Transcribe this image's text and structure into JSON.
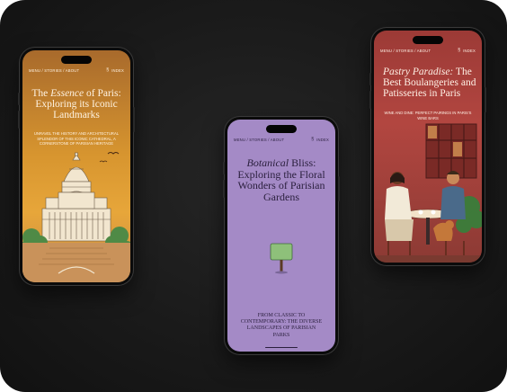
{
  "phones": [
    {
      "nav": {
        "links": "MENU / STORIES / ABOUT",
        "index": "INDEX"
      },
      "title": {
        "italic": "Essence",
        "pre": "The ",
        "post": " of Paris: Exploring its Iconic Landmarks"
      },
      "subtitle": "UNRAVEL THE HISTORY AND ARCHITECTURAL SPLENDOR OF THIS ICONIC CATHEDRAL, A CORNERSTONE OF PARISIAN HERITAGE",
      "illustration": "sacre-coeur-basilica"
    },
    {
      "nav": {
        "links": "MENU / STORIES / ABOUT",
        "index": "INDEX"
      },
      "title": {
        "italic": "Botanical",
        "post": " Bliss: Exploring the Floral Wonders of Parisian Gardens"
      },
      "subtitle": "FROM CLASSIC TO CONTEMPORARY: THE DIVERSE LANDSCAPES OF PARISIAN PARKS",
      "illustration": "topiary-tree"
    },
    {
      "nav": {
        "links": "MENU / STORIES / ABOUT",
        "index": "INDEX"
      },
      "title": {
        "italic": "Pastry Paradise:",
        "post": " The Best Boulangeries and Patisseries in Paris"
      },
      "subtitle": "WINE AND DINE: PERFECT PAIRINGS IN PARIS'S WINE BARS",
      "illustration": "cafe-couple-scene"
    }
  ],
  "colors": {
    "background": "#1a1a1a",
    "phone1_screen": "#d7952f",
    "phone2_screen": "#a48ac6",
    "phone3_screen": "#b24640"
  }
}
